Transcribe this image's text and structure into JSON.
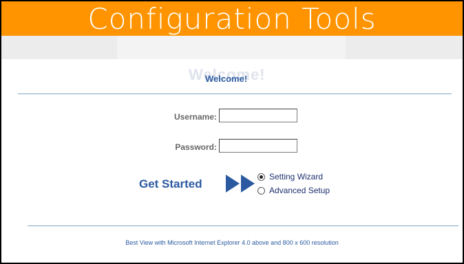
{
  "header": {
    "title": "Configuration Tools",
    "bg_color": "#ff9400"
  },
  "welcome": {
    "text": "Welcome!",
    "ghost_text": "Welcome!"
  },
  "login": {
    "username_label": "Username:",
    "username_value": "",
    "password_label": "Password:",
    "password_value": ""
  },
  "start": {
    "label": "Get Started",
    "options": [
      {
        "label": "Setting Wizard",
        "checked": true
      },
      {
        "label": "Advanced Setup",
        "checked": false
      }
    ]
  },
  "footer": {
    "note": "Best View with Microsoft Internet Explorer 4.0 above and 800 x 600 resolution"
  },
  "colors": {
    "accent_blue": "#2b5aa0",
    "divider": "#7fa6c9"
  }
}
